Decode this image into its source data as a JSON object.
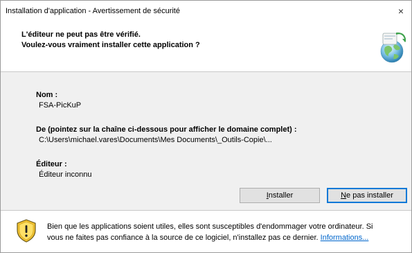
{
  "window": {
    "title": "Installation d'application - Avertissement de sécurité",
    "close_glyph": "×"
  },
  "header": {
    "line1": "L'éditeur ne peut pas être vérifié.",
    "line2": "Voulez-vous vraiment installer cette application ?",
    "icon": "globe-install-icon"
  },
  "details": {
    "name_label": "Nom :",
    "name_value": "FSA-PicKuP",
    "from_label": "De (pointez sur la chaîne ci-dessous pour afficher le domaine complet) :",
    "from_value": "C:\\Users\\michael.vares\\Documents\\Mes Documents\\_Outils-Copie\\...",
    "publisher_label": "Éditeur :",
    "publisher_value": "Éditeur inconnu"
  },
  "buttons": {
    "install_accel": "I",
    "install_rest": "nstaller",
    "dont_install_accel": "N",
    "dont_install_rest": "e pas installer"
  },
  "footer": {
    "icon": "warning-shield-icon",
    "warning_line1": "Bien que les applications soient utiles, elles sont susceptibles d'endommager votre ordinateur. Si",
    "warning_line2": "vous ne faites pas confiance à la source de ce logiciel, n'installez pas ce dernier. ",
    "more_info_link": "Informations..."
  },
  "colors": {
    "body_bg": "#f0f0f0",
    "button_bg": "#e1e1e1",
    "focus_border": "#0078d7",
    "link": "#0066cc"
  }
}
